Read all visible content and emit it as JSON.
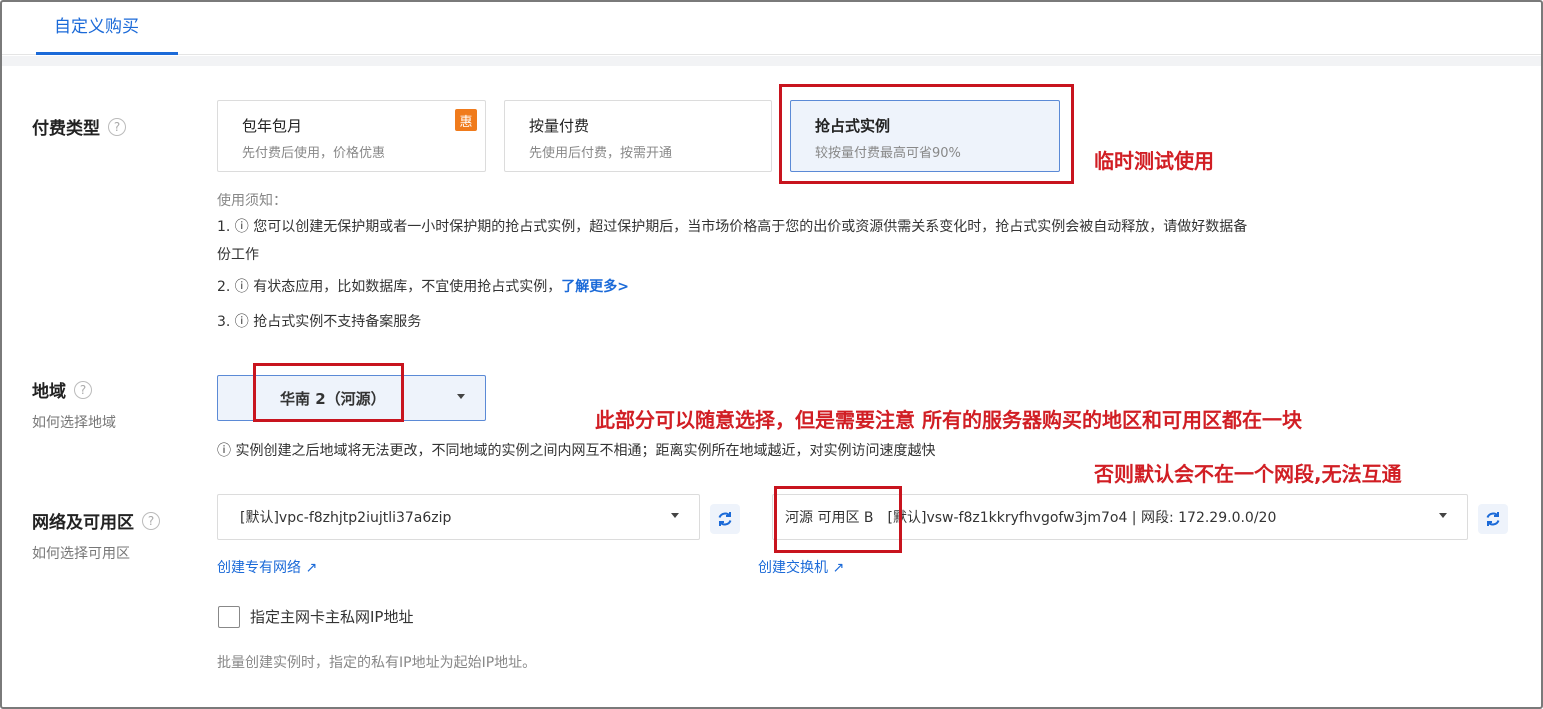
{
  "tab": {
    "label": "自定义购买"
  },
  "billing": {
    "label": "付费类型",
    "options": [
      {
        "title": "包年包月",
        "desc": "先付费后使用，价格优惠",
        "badge": "惠"
      },
      {
        "title": "按量付费",
        "desc": "先使用后付费，按需开通"
      },
      {
        "title": "抢占式实例",
        "desc": "较按量付费最高可省90%"
      }
    ],
    "notice_title": "使用须知：",
    "notice1_line1": "1. ⓘ 您可以创建无保护期或者一小时保护期的抢占式实例，超过保护期后，当市场价格高于您的出价或资源供需关系变化时，抢占式实例会被自动释放，请做好数据备",
    "notice1_line2": "份工作",
    "notice2": "2. ⓘ 有状态应用，比如数据库，不宜使用抢占式实例，",
    "notice2_link": "了解更多>",
    "notice3": "3. ⓘ 抢占式实例不支持备案服务"
  },
  "region": {
    "label": "地域",
    "sublabel": "如何选择地域",
    "selected": "华南 2（河源）",
    "note": "ⓘ 实例创建之后地域将无法更改，不同地域的实例之间内网互不相通；距离实例所在地域越近，对实例访问速度越快"
  },
  "network": {
    "label": "网络及可用区",
    "sublabel": "如何选择可用区",
    "vpc": "[默认]vpc-f8zhjtp2iujtli37a6zip",
    "zone": "河源 可用区 B",
    "vswitch": "[默认]vsw-f8z1kkryfhvgofw3jm7o4 | 网段: 172.29.0.0/20",
    "create_vpc": "创建专有网络",
    "create_vswitch": "创建交换机",
    "ip_checkbox": "指定主网卡主私网IP地址",
    "ip_note": "批量创建实例时，指定的私有IP地址为起始IP地址。"
  },
  "annotations": {
    "temp_test": "临时测试使用",
    "region_note": "此部分可以随意选择，但是需要注意 所有的服务器购买的地区和可用区都在一块",
    "network_note": "否则默认会不在一个网段,无法互通"
  },
  "colors": {
    "accent": "#1b6ad8",
    "annotation": "#d11e24",
    "badge": "#f07b1c"
  }
}
